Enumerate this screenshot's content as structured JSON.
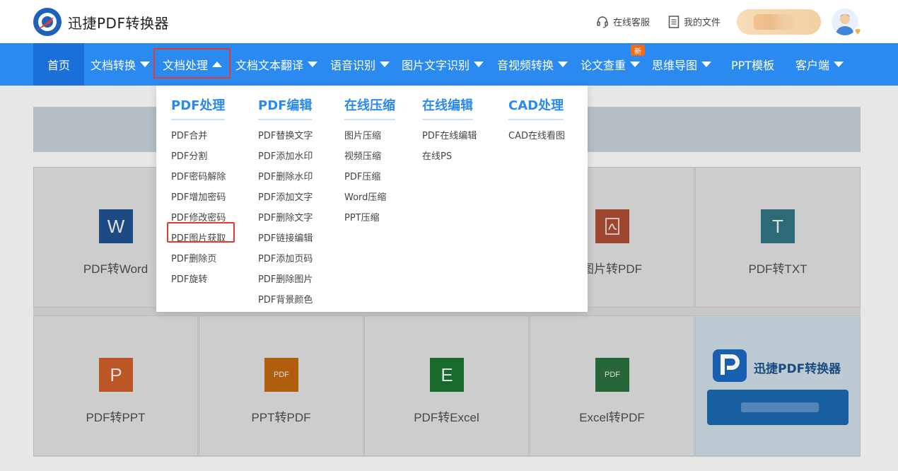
{
  "header": {
    "brand": "迅捷PDF转换器",
    "support_label": "在线客服",
    "files_label": "我的文件",
    "icons": [
      "logo",
      "headset-icon",
      "document-icon",
      "avatar",
      "vip-badge-icon"
    ]
  },
  "nav": {
    "items": [
      {
        "label": "首页",
        "caret": false
      },
      {
        "label": "文档转换",
        "caret": "down"
      },
      {
        "label": "文档处理",
        "caret": "up",
        "active": true
      },
      {
        "label": "文档文本翻译",
        "caret": "down"
      },
      {
        "label": "语音识别",
        "caret": "down"
      },
      {
        "label": "图片文字识别",
        "caret": "down"
      },
      {
        "label": "音视频转换",
        "caret": "down"
      },
      {
        "label": "论文查重",
        "caret": "down",
        "badge": "新"
      },
      {
        "label": "思维导图",
        "caret": "down"
      },
      {
        "label": "PPT模板",
        "caret": false
      },
      {
        "label": "客户端",
        "caret": "down"
      }
    ]
  },
  "dropdown": {
    "columns": [
      {
        "title": "PDF处理",
        "items": [
          "PDF合并",
          "PDF分割",
          "PDF密码解除",
          "PDF增加密码",
          "PDF修改密码",
          "PDF图片获取",
          "PDF删除页",
          "PDF旋转"
        ]
      },
      {
        "title": "PDF编辑",
        "items": [
          "PDF替换文字",
          "PDF添加水印",
          "PDF删除水印",
          "PDF添加文字",
          "PDF删除文字",
          "PDF链接编辑",
          "PDF添加页码",
          "PDF删除图片",
          "PDF背景颜色"
        ]
      },
      {
        "title": "在线压缩",
        "items": [
          "图片压缩",
          "视频压缩",
          "PDF压缩",
          "Word压缩",
          "PPT压缩"
        ]
      },
      {
        "title": "在线编辑",
        "items": [
          "PDF在线编辑",
          "在线PS"
        ]
      },
      {
        "title": "CAD处理",
        "items": [
          "CAD在线看图"
        ]
      }
    ]
  },
  "cards": {
    "row1": [
      {
        "label": "PDF转Word",
        "glyph": "W",
        "color": "#1e4f8a"
      },
      {
        "label": "图片转PDF",
        "glyph": "pdf",
        "color": "#a44a32"
      },
      {
        "label": "PDF转TXT",
        "glyph": "T",
        "color": "#2e6f7c"
      }
    ],
    "row2": [
      {
        "label": "PDF转PPT",
        "glyph": "P",
        "color": "#c45a28"
      },
      {
        "label": "PPT转PDF",
        "glyph": "PDF",
        "color": "#b8620f"
      },
      {
        "label": "PDF转Excel",
        "glyph": "E",
        "color": "#1a6f2e"
      },
      {
        "label": "Excel转PDF",
        "glyph": "PDF",
        "color": "#2a6b3a"
      }
    ],
    "promo_title": "迅捷PDF转换器"
  }
}
